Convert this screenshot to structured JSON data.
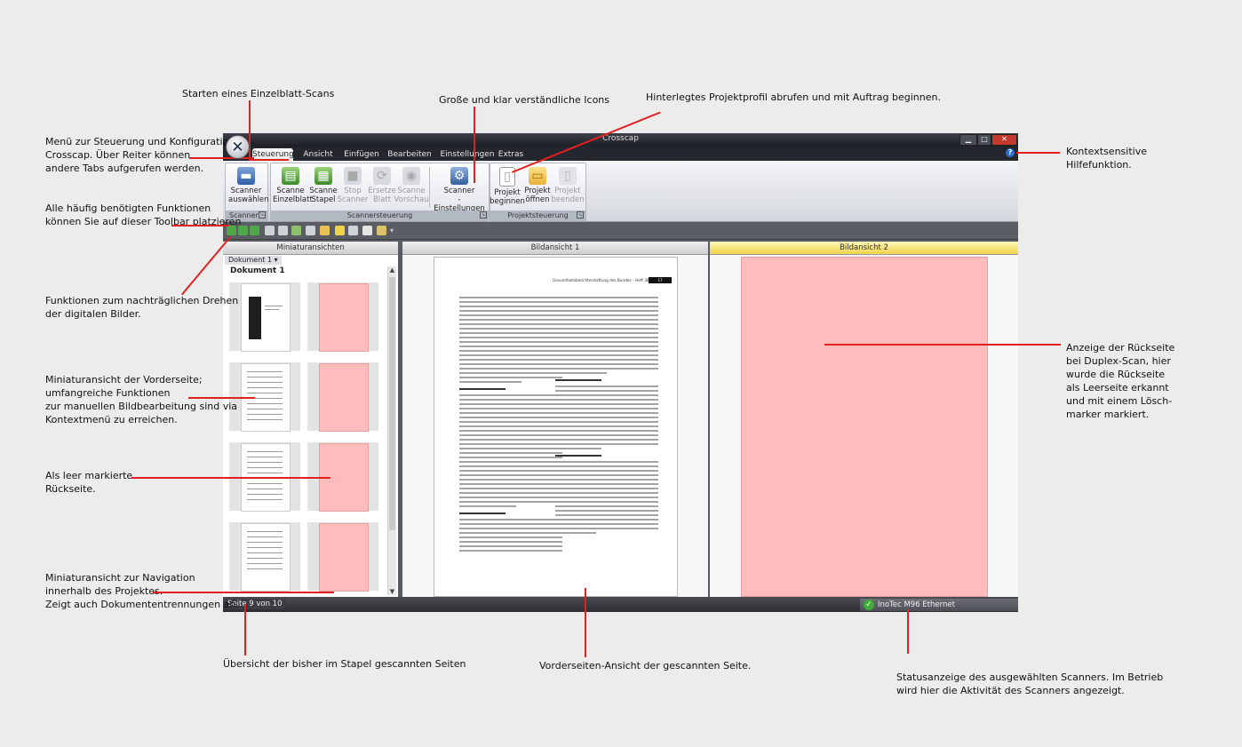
{
  "app": {
    "title": "Crosscap",
    "logo_glyph": "✕",
    "window_controls": {
      "min": "▁",
      "max": "□",
      "close": "✕"
    },
    "help_glyph": "?",
    "tabs": [
      "Steuerung",
      "Ansicht",
      "Einfügen",
      "Bearbeiten",
      "Einstellungen",
      "Extras"
    ],
    "active_tab": "Steuerung",
    "ribbon": {
      "scanner_group": {
        "label": "Scanner",
        "buttons": [
          {
            "line1": "Scanner",
            "line2": "auswählen",
            "icon": "scanner-icon"
          }
        ]
      },
      "scannersteuerung_group": {
        "label": "Scannersteuerung",
        "buttons": [
          {
            "line1": "Scanne",
            "line2": "Einzelblatt",
            "icon": "scan-single-icon",
            "enabled": true
          },
          {
            "line1": "Scanne",
            "line2": "Stapel",
            "icon": "scan-stack-icon",
            "enabled": true
          },
          {
            "line1": "Stop",
            "line2": "Scanner",
            "icon": "stop-icon",
            "enabled": false
          },
          {
            "line1": "Ersetze",
            "line2": "Blatt",
            "icon": "replace-icon",
            "enabled": false
          },
          {
            "line1": "Scanne",
            "line2": "Vorschau",
            "icon": "preview-icon",
            "enabled": false
          },
          {
            "line1": "Scanner",
            "line2": "-Einstellungen",
            "icon": "scanner-settings-icon",
            "enabled": true
          }
        ]
      },
      "projekt_group": {
        "label": "Projektsteuerung",
        "buttons": [
          {
            "line1": "Projekt",
            "line2": "beginnen",
            "icon": "new-project-icon",
            "enabled": true
          },
          {
            "line1": "Projekt",
            "line2": "öffnen",
            "icon": "open-folder-icon",
            "enabled": true
          },
          {
            "line1": "Projekt",
            "line2": "beenden",
            "icon": "close-project-icon",
            "enabled": false
          }
        ]
      }
    },
    "panes": {
      "thumbnails": {
        "header": "Miniaturansichten",
        "doc_selector": "Dokument 1 ▾",
        "doc_label": "Dokument 1"
      },
      "front": {
        "header": "Bildansicht 1"
      },
      "back": {
        "header": "Bildansicht 2"
      }
    },
    "document": {
      "running_head": "Gesundheitsberichterstattung des Bundes – Heft 38",
      "page_number": "17",
      "headings": [
        "Lebensqualität",
        "Rehabilitation",
        "Psychotherapeutische Behandlung",
        "Selbsthilfe"
      ]
    },
    "status": {
      "page_count": "Seite 9 von 10",
      "scanner": "InoTec M96 Ethernet",
      "scanner_ok": true
    }
  },
  "annotations": {
    "einzelblatt": "Starten eines Einzelblatt-Scans",
    "icons": "Große und klar verständliche Icons",
    "projektprofil": "Hinterlegtes Projektprofil abrufen und mit Auftrag beginnen.",
    "menu": [
      "Menü zur Steuerung und Konfiguration",
      "Crosscap. Über Reiter können",
      "andere Tabs aufgerufen werden."
    ],
    "hilfe": [
      "Kontextsensitive",
      "Hilfefunktion."
    ],
    "toolbar": [
      "Alle häufig benötigten Funktionen",
      "können Sie auf dieser Toolbar platzieren"
    ],
    "drehen": [
      "Funktionen zum nachträglichen Drehen",
      "der digitalen Bilder."
    ],
    "miniatur_vorder": [
      "Miniaturansicht der Vorderseite;",
      "umfangreiche Funktionen",
      "zur manuellen Bildbearbeitung sind via",
      "Kontextmenü zu erreichen."
    ],
    "leer": [
      "Als leer markierte",
      "Rückseite."
    ],
    "navigation": [
      "Miniaturansicht zur Navigation",
      "innerhalb des Projektes.",
      "Zeigt auch Dokumententrennungen an."
    ],
    "rueckseite": [
      "Anzeige der Rückseite",
      "bei Duplex-Scan, hier",
      "wurde die Rückseite",
      "als Leerseite erkannt",
      "und mit einem Lösch-",
      "marker markiert."
    ],
    "uebersicht": "Übersicht der bisher im Stapel gescannten Seiten",
    "vorderseite": "Vorderseiten-Ansicht der gescannten Seite.",
    "status": [
      "Statusanzeige des ausgewählten Scanners. Im Betrieb",
      "wird hier die Aktivität des Scanners angezeigt."
    ]
  },
  "colors": {
    "annotation_line": "#e32020",
    "blank_page": "#ffbcbc",
    "highlight_header": "#f0d24a",
    "ok": "#3fae3a"
  }
}
